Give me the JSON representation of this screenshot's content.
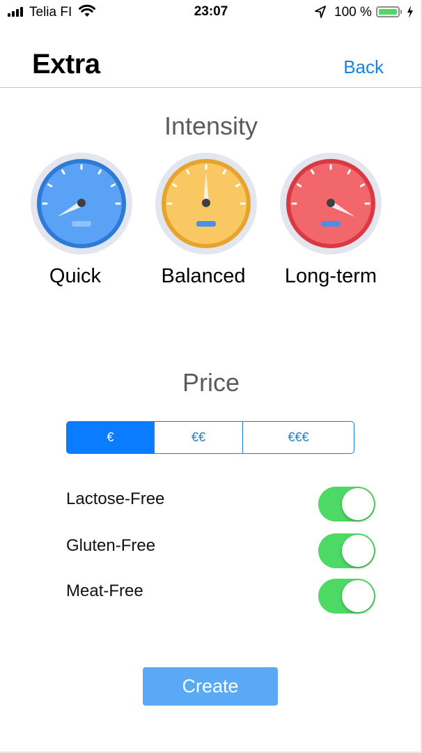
{
  "status_bar": {
    "carrier": "Telia FI",
    "time": "23:07",
    "battery_percent": "100 %",
    "battery_level": 1.0
  },
  "nav": {
    "title": "Extra",
    "back_label": "Back"
  },
  "intensity": {
    "title": "Intensity",
    "options": [
      {
        "label": "Quick",
        "color": "#4a90e2"
      },
      {
        "label": "Balanced",
        "color": "#f5b944"
      },
      {
        "label": "Long-term",
        "color": "#e8474e"
      }
    ]
  },
  "price": {
    "title": "Price",
    "options": [
      "€",
      "€€",
      "€€€"
    ],
    "selected_index": 0
  },
  "filters": [
    {
      "label": "Lactose-Free",
      "on": true
    },
    {
      "label": "Gluten-Free",
      "on": true
    },
    {
      "label": "Meat-Free",
      "on": true
    }
  ],
  "create_label": "Create",
  "colors": {
    "accent": "#0a7cff",
    "toggle_on": "#4cd964",
    "create_button": "#5aa9f7"
  }
}
